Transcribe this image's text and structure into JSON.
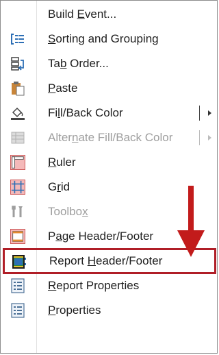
{
  "menu": {
    "items": [
      {
        "label_pre": "Build ",
        "label_acc": "E",
        "label_post": "vent...",
        "icon": "none"
      },
      {
        "label_pre": "",
        "label_acc": "S",
        "label_post": "orting and Grouping",
        "icon": "sorting-grouping-icon"
      },
      {
        "label_pre": "Ta",
        "label_acc": "b",
        "label_post": " Order...",
        "icon": "tab-order-icon"
      },
      {
        "label_pre": "",
        "label_acc": "P",
        "label_post": "aste",
        "icon": "paste-icon"
      },
      {
        "label_pre": "Fi",
        "label_acc": "l",
        "label_post": "l/Back Color",
        "icon": "fill-back-color-icon"
      },
      {
        "label_pre": "Alter",
        "label_acc": "n",
        "label_post": "ate Fill/Back Color",
        "icon": "alternate-fill-icon"
      },
      {
        "label_pre": "",
        "label_acc": "R",
        "label_post": "uler",
        "icon": "ruler-icon"
      },
      {
        "label_pre": "G",
        "label_acc": "r",
        "label_post": "id",
        "icon": "grid-icon"
      },
      {
        "label_pre": "Toolbo",
        "label_acc": "x",
        "label_post": "",
        "icon": "toolbox-icon"
      },
      {
        "label_pre": "P",
        "label_acc": "a",
        "label_post": "ge Header/Footer",
        "icon": "page-header-footer-icon"
      },
      {
        "label_pre": "Report ",
        "label_acc": "H",
        "label_post": "eader/Footer",
        "icon": "report-header-footer-icon"
      },
      {
        "label_pre": "",
        "label_acc": "R",
        "label_post": "eport Properties",
        "icon": "report-properties-icon"
      },
      {
        "label_pre": "",
        "label_acc": "P",
        "label_post": "roperties",
        "icon": "properties-icon"
      }
    ]
  },
  "colors": {
    "highlight_border": "#b01e27",
    "annotation_arrow": "#c21b1b",
    "disabled_text": "#9e9e9e"
  }
}
